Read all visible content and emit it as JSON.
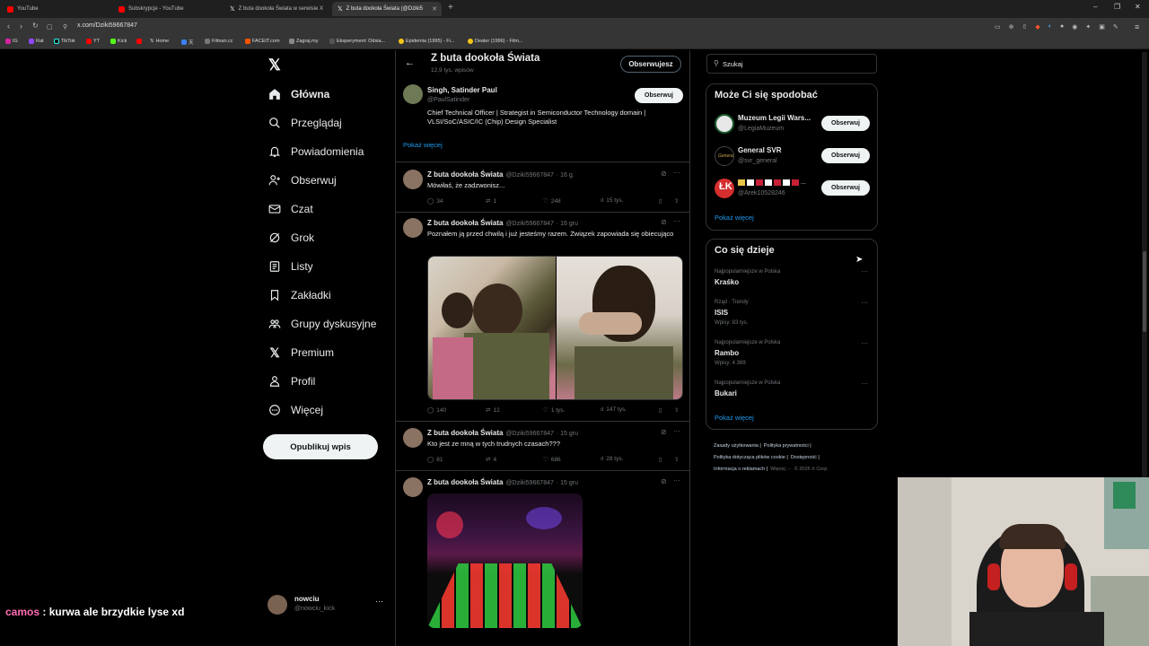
{
  "browser": {
    "tabs": [
      {
        "label": "YouTube",
        "favicon_color": "#ff0000"
      },
      {
        "label": "Subskrypcje - YouTube",
        "favicon_color": "#ff0000"
      },
      {
        "label": "Z buta dookoła Świata w serwisie X",
        "favicon_icon": "x-icon"
      },
      {
        "label": "Z buta dookoła Świata (@Dziki5",
        "favicon_icon": "x-icon",
        "active": true
      }
    ],
    "url": "x.com/Dziki59667847",
    "bookmarks": [
      "IG",
      "Rat",
      "TikTok",
      "YT",
      "Kick",
      "Home",
      "Filman.cc",
      "FACEIT.com",
      "Zagraj.my",
      "Eksperyment: Odsia...",
      "Epidemia (1995) - Fi...",
      "Dealer (1996) - Film..."
    ]
  },
  "sidebar": {
    "items": [
      {
        "label": "Główna",
        "icon": "home-icon"
      },
      {
        "label": "Przeglądaj",
        "icon": "search-icon"
      },
      {
        "label": "Powiadomienia",
        "icon": "bell-icon"
      },
      {
        "label": "Obserwuj",
        "icon": "add-user-icon"
      },
      {
        "label": "Czat",
        "icon": "mail-icon"
      },
      {
        "label": "Grok",
        "icon": "grok-icon"
      },
      {
        "label": "Listy",
        "icon": "list-icon"
      },
      {
        "label": "Zakładki",
        "icon": "bookmark-icon"
      },
      {
        "label": "Grupy dyskusyjne",
        "icon": "communities-icon"
      },
      {
        "label": "Premium",
        "icon": "x-icon"
      },
      {
        "label": "Profil",
        "icon": "profile-icon"
      },
      {
        "label": "Więcej",
        "icon": "more-icon"
      }
    ],
    "post_button": "Opublikuj wpis",
    "account": {
      "name": "nowciu",
      "handle": "@nowciu_kick"
    }
  },
  "header": {
    "title": "Z buta dookoła Świata",
    "subtitle": "12,9 tys. wpisów",
    "follow": "Obserwujesz"
  },
  "suggested": {
    "name": "Singh, Satinder Paul",
    "handle": "@PaulSatinder",
    "follow": "Obserwuj",
    "bio": "Chief Technical Officer | Strategist in Semiconductor Technology domain | VLSI/SoC/ASIC/IC (Chip) Design Specialist",
    "show_more": "Pokaż więcej"
  },
  "posts": [
    {
      "name": "Z buta dookoła Świata",
      "handle": "@Dziki59667847",
      "time": "· 16 g.",
      "text": "Mówiłaś, że zadzwonisz...",
      "replies": "34",
      "reposts": "1",
      "likes": "248",
      "views": "15 tys."
    },
    {
      "name": "Z buta dookoła Świata",
      "handle": "@Dziki59667847",
      "time": "· 16 gru",
      "text": "Poznałem ją przed chwilą i już jesteśmy razem. Związek zapowiada się obiecująco",
      "replies": "140",
      "reposts": "12",
      "likes": "1 tys.",
      "views": "147 tys."
    },
    {
      "name": "Z buta dookoła Świata",
      "handle": "@Dziki59667847",
      "time": "· 15 gru",
      "text": "Kto jest ze mną w tych trudnych czasach???",
      "replies": "81",
      "reposts": "4",
      "likes": "686",
      "views": "28 tys."
    },
    {
      "name": "Z buta dookoła Świata",
      "handle": "@Dziki59667847",
      "time": "· 15 gru",
      "text": ""
    }
  ],
  "right": {
    "search_placeholder": "Szukaj",
    "wtf_title": "Może Ci się spodobać",
    "wtf": [
      {
        "name": "Muzeum Legii Wars...",
        "handle": "@LegiaMuzeum",
        "follow": "Obserwuj"
      },
      {
        "name": "General SVR",
        "handle": "@svr_general",
        "follow": "Obserwuj"
      },
      {
        "name": "",
        "handle": "@Arek10528246",
        "follow": "Obserwuj"
      }
    ],
    "wtf_more": "Pokaż więcej",
    "trends_title": "Co się dzieje",
    "trends": [
      {
        "top": "Najpopularniejsze w Polska",
        "name": "Kraśko",
        "count": ""
      },
      {
        "top": "Rząd · Trendy",
        "name": "ISIS",
        "count": "Wpisy: 83 tys."
      },
      {
        "top": "Najpopularniejsze w Polska",
        "name": "Rambo",
        "count": "Wpisy: 4 369"
      },
      {
        "top": "Najpopularniejsze w Polska",
        "name": "Bukari",
        "count": ""
      }
    ],
    "trends_more": "Pokaż więcej",
    "footer": [
      "Zasady użytkowania",
      "Polityka prywatności",
      "Polityka dotycząca plików cookie",
      "Dostępność",
      "Informacja o reklamach",
      "Więcej ···",
      "© 2025 X Corp."
    ]
  },
  "chat_overlay": {
    "user": "camos",
    "message": " : kurwa ale brzydkie lyse  xd"
  }
}
